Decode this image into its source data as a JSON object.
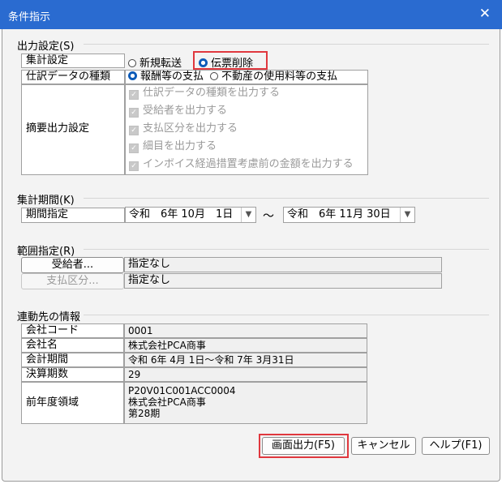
{
  "window": {
    "title": "条件指示",
    "close": "✕"
  },
  "output_settings": {
    "section": "出力設定(S)",
    "aggregate_label": "集計設定",
    "aggregate_options": [
      "新規転送",
      "伝票削除"
    ],
    "journal_label": "仕訳データの種類",
    "journal_options": [
      "報酬等の支払",
      "不動産の使用料等の支払"
    ],
    "summary_label": "摘要出力設定",
    "summary_items": [
      "仕訳データの種類を出力する",
      "受給者を出力する",
      "支払区分を出力する",
      "細目を出力する",
      "インボイス経過措置考慮前の金額を出力する"
    ]
  },
  "period": {
    "section": "集計期間(K)",
    "label": "期間指定",
    "from": "令和　6年 10月　1日",
    "separator": "〜",
    "to": "令和　6年 11月 30日"
  },
  "range": {
    "section": "範囲指定(R)",
    "recipient_button": "受給者...",
    "recipient_value": "指定なし",
    "payment_button": "支払区分...",
    "payment_value": "指定なし"
  },
  "link_info": {
    "section": "連動先の情報",
    "rows": [
      {
        "label": "会社コード",
        "value": "0001"
      },
      {
        "label": "会社名",
        "value": "株式会社PCA商事"
      },
      {
        "label": "会計期間",
        "value": "令和 6年 4月 1日〜令和 7年 3月31日"
      },
      {
        "label": "決算期数",
        "value": "29"
      }
    ],
    "prev_label": "前年度領域",
    "prev_lines": [
      "P20V01C001ACC0004",
      "株式会社PCA商事",
      "第28期"
    ]
  },
  "buttons": {
    "output": "画面出力(F5)",
    "cancel": "キャンセル",
    "help": "ヘルプ(F1)"
  },
  "colors": {
    "titlebar": "#2a6bd0",
    "highlight": "#e0383e",
    "radio_selected": "#0d5bb8"
  }
}
